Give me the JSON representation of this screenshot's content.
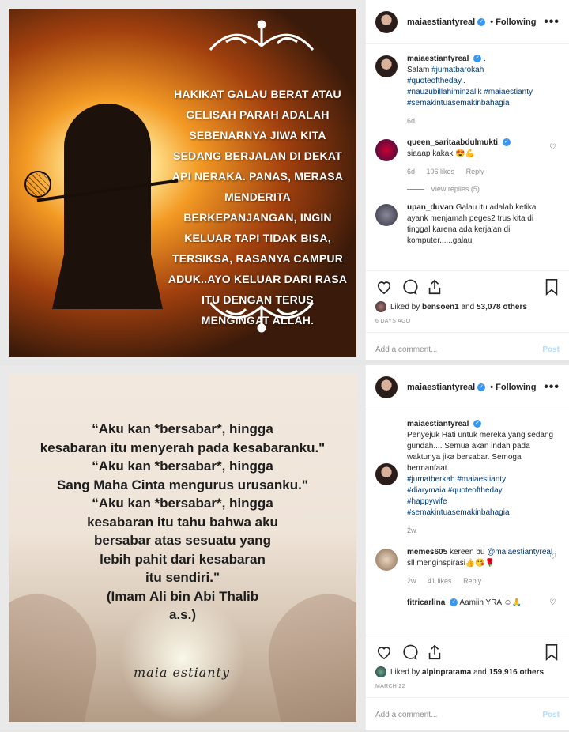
{
  "post1": {
    "username": "maiaestiantyreal",
    "follow_status": "Following",
    "image_quote": "Hakikat galau berat atau gelisah parah adalah sebenarnya jiwa kita sedang berjalan di dekat api neraka. Panas, merasa menderita berkepanjangan, ingin keluar tapi tidak bisa, tersiksa, rasanya campur aduk..ayo keluar dari rasa itu dengan terus mengingat Allah.",
    "caption": {
      "username": "maiaestiantyreal",
      "text_before": ".",
      "line2": "Salam ",
      "tags": [
        "#jumatbarokah",
        "#quoteoftheday..",
        "#nauzubillahiminzalik",
        "#maiaestianty",
        "#semakintuasemakinbahagia"
      ],
      "time": "6d"
    },
    "comments": [
      {
        "username": "queen_saritaabdulmukti",
        "text": "siaaap kakak 😍💪",
        "time": "6d",
        "likes": "106 likes",
        "reply": "Reply",
        "view_replies": "View replies (5)"
      },
      {
        "username": "upan_duvan",
        "text": "Galau itu adalah ketika ayank menjamah peges2 trus kita di tinggal karena ada kerja'an di komputer......galau"
      }
    ],
    "liked_by_prefix": "Liked by",
    "liked_by_user": "bensoen1",
    "liked_by_and": "and",
    "liked_by_count": "53,078 others",
    "date": "6 DAYS AGO",
    "add_comment_placeholder": "Add a comment...",
    "post_label": "Post"
  },
  "post2": {
    "username": "maiaestiantyreal",
    "follow_status": "Following",
    "image_quote_lines": [
      "“Aku kan *bersabar*, hingga",
      "kesabaran itu menyerah pada kesabaranku.\"",
      "“Aku kan *bersabar*, hingga",
      "Sang Maha Cinta mengurus urusanku.\"",
      "“Aku kan *bersabar*, hingga",
      "kesabaran itu tahu bahwa aku",
      "bersabar atas sesuatu yang",
      "lebih pahit dari kesabaran",
      "itu sendiri.\"",
      "(Imam Ali bin Abi Thalib",
      "a.s.)"
    ],
    "signature": "maia estianty",
    "caption": {
      "username": "maiaestiantyreal",
      "text": "Penyejuk Hati untuk mereka yang sedang gundah.... Semua akan indah pada waktunya jika bersabar. Semoga bermanfaat.",
      "tags": [
        "#jumatberkah",
        "#maiaestianty",
        "#diarymaia",
        "#quoteoftheday",
        "#happywife",
        "#semakintuasemakinbahagia"
      ],
      "time": "2w"
    },
    "comments": [
      {
        "username": "memes605",
        "text_before": "kereen bu ",
        "mention": "@maiaestiantyreal",
        "text_after": " sll menginspirasi👍😘🌹",
        "time": "2w",
        "likes": "41 likes",
        "reply": "Reply"
      },
      {
        "username": "fitricarlina",
        "text": "Aamiin YRA ☺🙏"
      }
    ],
    "liked_by_prefix": "Liked by",
    "liked_by_user": "alpinpratama",
    "liked_by_and": "and",
    "liked_by_count": "159,916 others",
    "date": "MARCH 22",
    "add_comment_placeholder": "Add a comment...",
    "post_label": "Post"
  },
  "icons": {
    "verified": "✓",
    "more": "•••",
    "heart_small": "♡"
  }
}
